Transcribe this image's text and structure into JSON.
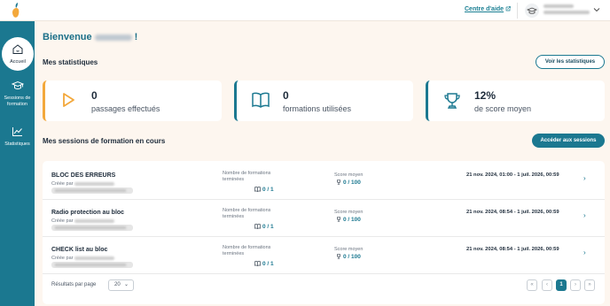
{
  "header": {
    "help_link": "Centre d'aide",
    "brand_color": "#1b7890"
  },
  "sidebar": {
    "items": [
      {
        "label": "Accueil",
        "icon": "home-icon",
        "active": true
      },
      {
        "label": "Sessions de formation",
        "icon": "graduation-cap-icon",
        "active": false
      },
      {
        "label": "Statistiques",
        "icon": "chart-icon",
        "active": false
      }
    ]
  },
  "main": {
    "welcome_prefix": "Bienvenue",
    "welcome_suffix": "!",
    "stats_title": "Mes statistiques",
    "stats_button": "Voir les statistiques",
    "stats": [
      {
        "value": "0",
        "label": "passages effectués",
        "accent": "#f3a83b",
        "icon": "play-icon"
      },
      {
        "value": "0",
        "label": "formations utilisées",
        "accent": "#1b7890",
        "icon": "book-icon"
      },
      {
        "value": "12%",
        "label": "de score moyen",
        "accent": "#1b7890",
        "icon": "trophy-icon"
      }
    ],
    "sessions_title": "Mes sessions de formation en cours",
    "sessions_button": "Accéder aux sessions",
    "col_formations_label": "Nombre de formations terminées",
    "col_score_label": "Score moyen",
    "created_by": "Créée par",
    "sessions": [
      {
        "title": "BLOC DES ERREURS",
        "formations": "0 / 1",
        "score": "0 / 100",
        "dates": "21 nov. 2024, 01:00 - 1 juil. 2026, 00:59"
      },
      {
        "title": "Radio protection au bloc",
        "formations": "0 / 1",
        "score": "0 / 100",
        "dates": "21 nov. 2024, 08:54 - 1 juil. 2026, 00:59"
      },
      {
        "title": "CHECK list au bloc",
        "formations": "0 / 1",
        "score": "0 / 100",
        "dates": "21 nov. 2024, 08:54 - 1 juil. 2026, 00:59"
      }
    ],
    "pagination": {
      "per_page_label": "Résultats par page",
      "per_page_value": "20",
      "current_page": "1"
    }
  }
}
